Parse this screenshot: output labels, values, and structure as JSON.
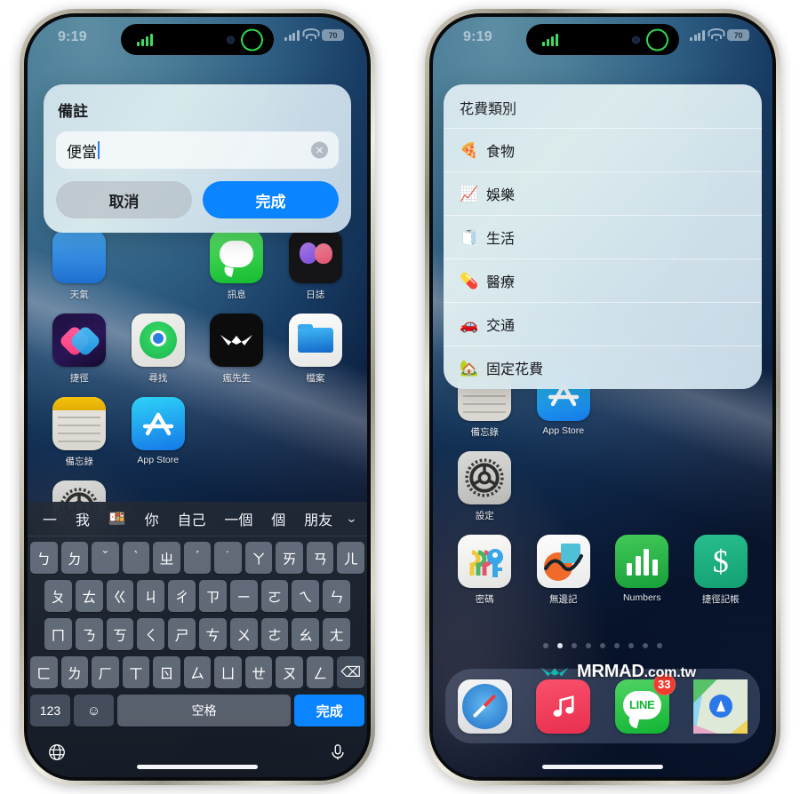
{
  "status_bar": {
    "time": "9:19",
    "battery": "70",
    "signal_icon": "cellular-signal-icon",
    "wifi_icon": "wifi-icon",
    "battery_icon": "battery-icon",
    "island_bars_icon": "audio-bars-icon",
    "island_ring_icon": "recording-ring-icon"
  },
  "left_phone": {
    "alert": {
      "title": "備註",
      "input_value": "便當",
      "input_placeholder": "",
      "clear_icon": "clear-text-icon",
      "cancel_label": "取消",
      "done_label": "完成"
    },
    "home_rows": [
      [
        {
          "label": "天氣",
          "icon": "weather-app-icon"
        },
        {
          "label": "",
          "icon": "empty-slot"
        },
        {
          "label": "訊息",
          "icon": "messages-app-icon"
        },
        {
          "label": "日誌",
          "icon": "journal-app-icon"
        }
      ],
      [
        {
          "label": "捷徑",
          "icon": "shortcuts-app-icon"
        },
        {
          "label": "尋找",
          "icon": "find-my-app-icon"
        },
        {
          "label": "瘋先生",
          "icon": "mrmad-app-icon"
        },
        {
          "label": "檔案",
          "icon": "files-app-icon"
        }
      ],
      [
        {
          "label": "備忘錄",
          "icon": "notes-app-icon"
        },
        {
          "label": "App Store",
          "icon": "app-store-icon"
        },
        {
          "label": "",
          "icon": "empty-slot"
        },
        {
          "label": "",
          "icon": "empty-slot"
        }
      ],
      [
        {
          "label": "設定",
          "icon": "settings-app-icon"
        },
        {
          "label": "",
          "icon": "empty-slot"
        },
        {
          "label": "",
          "icon": "empty-slot"
        },
        {
          "label": "",
          "icon": "empty-slot"
        }
      ]
    ],
    "keyboard": {
      "suggestions": [
        "一",
        "我",
        "🍱",
        "你",
        "自己",
        "一個",
        "個",
        "朋友"
      ],
      "collapse_icon": "chevron-down-icon",
      "row1": [
        "ㄅ",
        "ㄉ",
        "ˇ",
        "ˋ",
        "ㄓ",
        "ˊ",
        "˙",
        "ㄚ",
        "ㄞ",
        "ㄢ",
        "ㄦ"
      ],
      "row2": [
        "ㄆ",
        "ㄊ",
        "ㄍ",
        "ㄐ",
        "ㄔ",
        "ㄗ",
        "ㄧ",
        "ㄛ",
        "ㄟ",
        "ㄣ"
      ],
      "row3": [
        "ㄇ",
        "ㄋ",
        "ㄎ",
        "ㄑ",
        "ㄕ",
        "ㄘ",
        "ㄨ",
        "ㄜ",
        "ㄠ",
        "ㄤ"
      ],
      "row4": [
        "ㄈ",
        "ㄌ",
        "ㄏ",
        "ㄒ",
        "ㄖ",
        "ㄙ",
        "ㄩ",
        "ㄝ",
        "ㄡ",
        "ㄥ"
      ],
      "backspace_icon": "backspace-icon",
      "numeric_label": "123",
      "emoji_icon": "emoji-icon",
      "space_label": "空格",
      "return_label": "完成",
      "globe_icon": "globe-icon",
      "mic_icon": "microphone-icon"
    }
  },
  "right_phone": {
    "sheet": {
      "title": "花費類別",
      "rows": [
        {
          "emoji": "🍕",
          "label": "食物",
          "icon": "pizza-icon"
        },
        {
          "emoji": "📈",
          "label": "娛樂",
          "icon": "chart-increasing-icon"
        },
        {
          "emoji": "🧻",
          "label": "生活",
          "icon": "toilet-paper-icon"
        },
        {
          "emoji": "💊",
          "label": "醫療",
          "icon": "pill-icon"
        },
        {
          "emoji": "🚗",
          "label": "交通",
          "icon": "car-icon"
        },
        {
          "emoji": "🏡",
          "label": "固定花費",
          "icon": "house-icon"
        }
      ]
    },
    "home_rows": [
      [
        {
          "label": "備忘錄",
          "icon": "notes-app-icon"
        },
        {
          "label": "App Store",
          "icon": "app-store-icon"
        },
        {
          "label": "",
          "icon": "empty-slot"
        },
        {
          "label": "",
          "icon": "empty-slot"
        }
      ],
      [
        {
          "label": "設定",
          "icon": "settings-app-icon"
        },
        {
          "label": "",
          "icon": "empty-slot"
        },
        {
          "label": "",
          "icon": "empty-slot"
        },
        {
          "label": "",
          "icon": "empty-slot"
        }
      ],
      [
        {
          "label": "密碼",
          "icon": "passwords-app-icon"
        },
        {
          "label": "無邊記",
          "icon": "freeform-app-icon"
        },
        {
          "label": "Numbers",
          "icon": "numbers-app-icon"
        },
        {
          "label": "捷徑記帳",
          "icon": "expense-tracker-icon"
        }
      ]
    ],
    "page_dots": {
      "count": 9,
      "active_index": 1
    },
    "watermark": {
      "brand": "MRMAD",
      "suffix": ".com.tw",
      "logo_icon": "mrmad-logo-icon"
    },
    "dock": [
      {
        "label": "Safari",
        "icon": "safari-icon",
        "badge": ""
      },
      {
        "label": "音樂",
        "icon": "music-icon",
        "badge": ""
      },
      {
        "label": "LINE",
        "icon": "line-icon",
        "badge": "33"
      },
      {
        "label": "地圖",
        "icon": "maps-icon",
        "badge": ""
      }
    ]
  },
  "colors": {
    "accent_blue": "#0a84ff",
    "badge_red": "#f03b2e",
    "island_green": "#2fd94f"
  }
}
